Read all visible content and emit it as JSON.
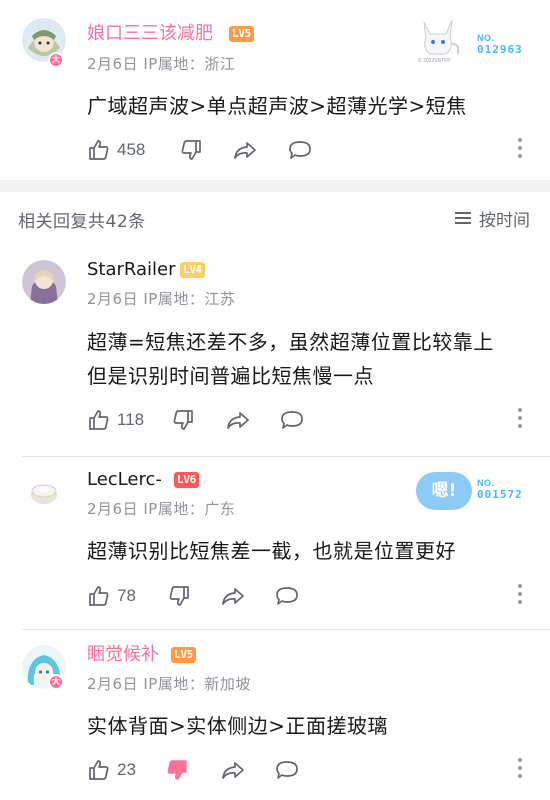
{
  "colors": {
    "pink_name": "#fb7299",
    "text": "#18191c",
    "meta": "#8f939a",
    "action": "#61666d",
    "fan_blue": "#47b6ff",
    "band": "#f1f2f3",
    "dislike_active": "#fb7299"
  },
  "main_comment": {
    "username": "娘口三三该减肥",
    "level": "LV5",
    "meta": "2月6日 IP属地：浙江",
    "content": "广域超声波>单点超声波>超薄光学>短焦",
    "like_count": "458",
    "fan_badge": {
      "no_label": "NO.",
      "number": "012963",
      "mascot_caption": "© 2022SNTFP"
    },
    "avatar_badge": "大"
  },
  "replies_header": {
    "title": "相关回复共42条",
    "sort_label": "按时间"
  },
  "replies": [
    {
      "username": "StarRailer",
      "level": "LV4",
      "meta": "2月6日 IP属地：江苏",
      "content_line1": "超薄=短焦还差不多，虽然超薄位置比较靠上",
      "content_line2": "但是识别时间普遍比短焦慢一点",
      "like_count": "118"
    },
    {
      "username": "LecLerc-",
      "level": "LV6",
      "meta": "2月6日 IP属地：广东",
      "content": "超薄识别比短焦差一截，也就是位置更好",
      "like_count": "78",
      "bubble_text": "嗯!",
      "fan_badge": {
        "no_label": "NO.",
        "number": "001572"
      }
    },
    {
      "username": "睏觉候补",
      "level": "LV5",
      "meta": "2月6日 IP属地：新加坡",
      "content": "实体背面>实体侧边>正面搓玻璃",
      "like_count": "23",
      "avatar_badge": "大"
    }
  ],
  "icons": [
    "thumbs-up-icon",
    "thumbs-down-icon",
    "share-icon",
    "comment-bubble-icon",
    "more-dots-icon",
    "sort-lines-icon"
  ]
}
